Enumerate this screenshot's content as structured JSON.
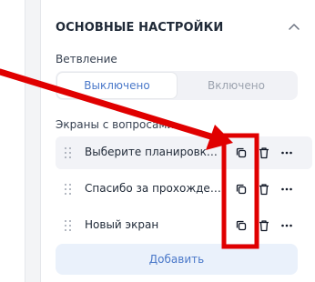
{
  "section": {
    "title": "ОСНОВНЫЕ НАСТРОЙКИ"
  },
  "branching": {
    "label": "Ветвление",
    "options": [
      "Выключено",
      "Включено"
    ],
    "selected": "Выключено"
  },
  "screens": {
    "label": "Экраны с вопросами",
    "items": [
      {
        "label": "Выберите планировку ва..."
      },
      {
        "label": "Спасибо за прохождение"
      },
      {
        "label": "Новый экран"
      }
    ]
  },
  "add_button": {
    "label": "Добавить"
  },
  "colors": {
    "accent": "#4a78c9",
    "annotation": "#e00000"
  },
  "icons": [
    "chevron-up-icon",
    "drag-handle-icon",
    "copy-icon",
    "trash-icon",
    "more-icon",
    "annotation-arrow",
    "annotation-box"
  ]
}
